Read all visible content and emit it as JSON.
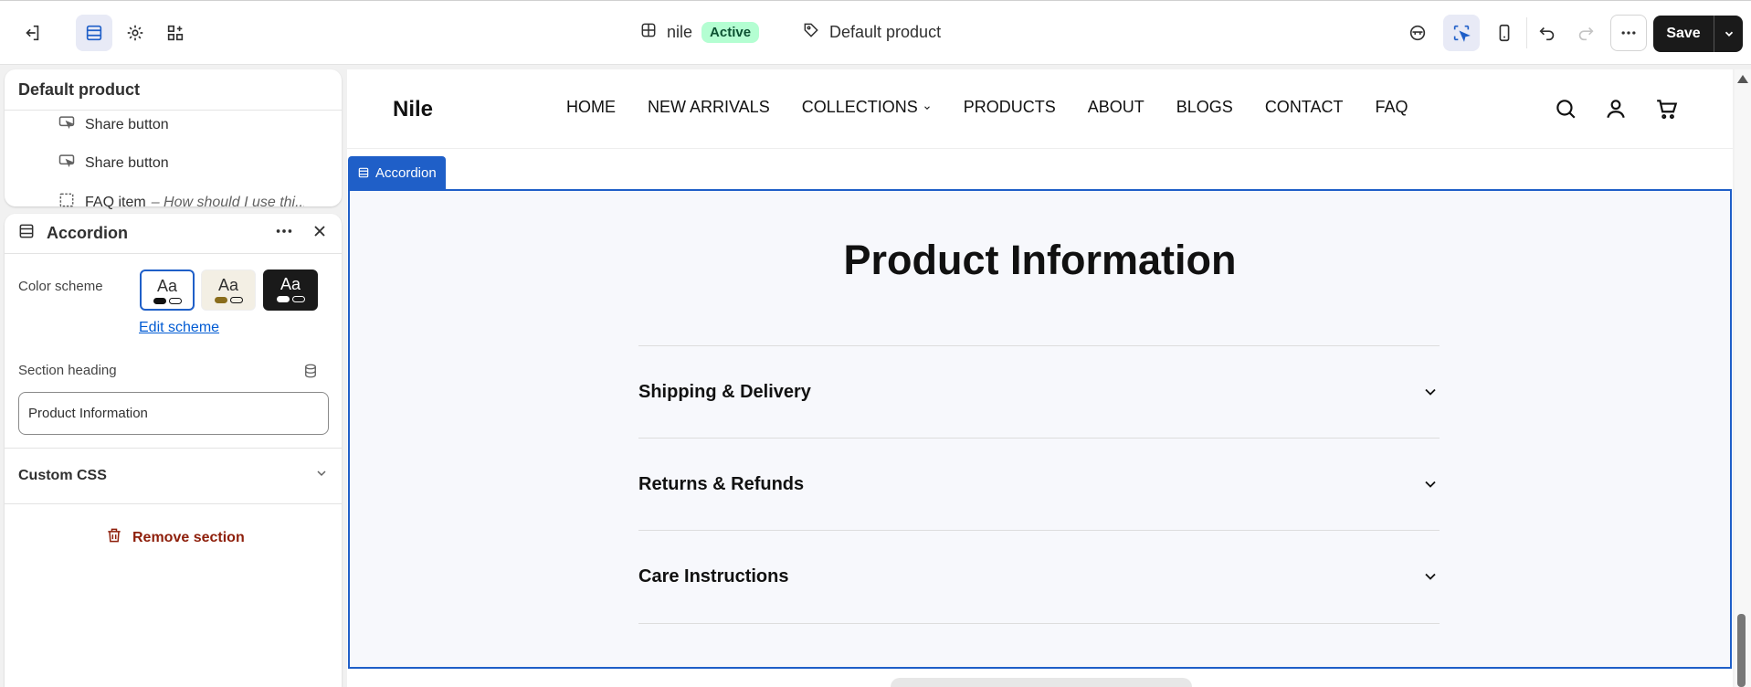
{
  "topbar": {
    "store_name": "nile",
    "status_badge": "Active",
    "template_name": "Default product",
    "save_label": "Save",
    "icons": [
      "exit-icon",
      "sections-icon",
      "settings-icon",
      "apps-icon",
      "theme-icon",
      "inspector-icon",
      "mobile-icon",
      "undo-icon",
      "redo-icon",
      "more-icon"
    ]
  },
  "sidebar_tree": {
    "title": "Default product",
    "items": [
      {
        "label": "Share button",
        "icon": "share-button-icon"
      },
      {
        "label": "Share button",
        "icon": "share-button-icon"
      },
      {
        "label": "FAQ item",
        "subtitle": "– How should I use thi...",
        "icon": "block-icon"
      }
    ]
  },
  "section_panel": {
    "title": "Accordion",
    "color_scheme_label": "Color scheme",
    "schemes": [
      {
        "text": "Aa",
        "bg": "#ffffff",
        "fg": "#111111",
        "dot": "#111111",
        "selected": true
      },
      {
        "text": "Aa",
        "bg": "#f3efe4",
        "fg": "#111111",
        "dot": "#8a6d1c",
        "selected": false
      },
      {
        "text": "Aa",
        "bg": "#1a1a1a",
        "fg": "#ffffff",
        "dot": "#ffffff",
        "selected": false
      }
    ],
    "edit_scheme_label": "Edit scheme",
    "heading_label": "Section heading",
    "heading_value": "Product Information",
    "custom_css_label": "Custom CSS",
    "remove_label": "Remove section"
  },
  "preview": {
    "logo": "Nile",
    "nav": [
      "HOME",
      "NEW ARRIVALS",
      "COLLECTIONS",
      "PRODUCTS",
      "ABOUT",
      "BLOGS",
      "CONTACT",
      "FAQ"
    ],
    "section_tag": "Accordion",
    "heading": "Product Information",
    "accordion_items": [
      "Shipping & Delivery",
      "Returns & Refunds",
      "Care Instructions"
    ]
  },
  "colors": {
    "accent": "#1f5fc8",
    "active_badge": "#b4fed2",
    "danger": "#8e1f0b",
    "link": "#005bd3"
  }
}
